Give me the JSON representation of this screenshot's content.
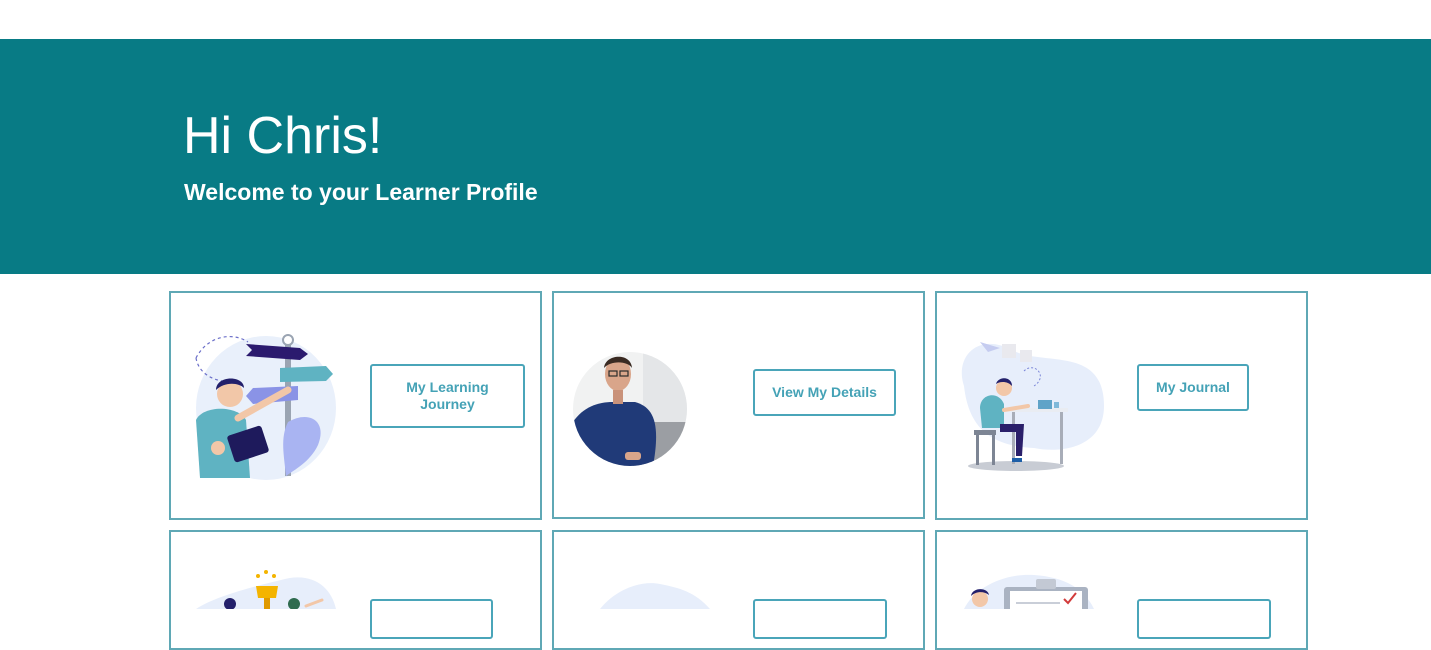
{
  "hero": {
    "greeting": "Hi Chris!",
    "subtitle": "Welcome to your Learner Profile"
  },
  "cards": [
    {
      "button_label": "My Learning Journey",
      "illustration": "signpost-illustration"
    },
    {
      "button_label": "View My Details",
      "illustration": "profile-photo"
    },
    {
      "button_label": "My Journal",
      "illustration": "desk-writing-illustration"
    },
    {
      "button_label": "",
      "illustration": "trophy-team-illustration"
    },
    {
      "button_label": "",
      "illustration": "blob-illustration"
    },
    {
      "button_label": "",
      "illustration": "clipboard-illustration"
    }
  ],
  "colors": {
    "hero_background": "#087b85",
    "card_border": "#5fa8b5",
    "button_text": "#44a2b6"
  }
}
